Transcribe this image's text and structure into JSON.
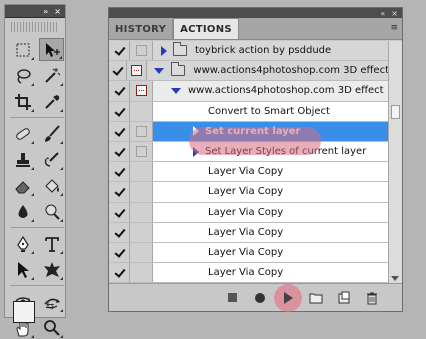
{
  "tools_panel": {
    "collapse_glyph": "»",
    "close_glyph": "×",
    "tools": [
      {
        "name": "rectangular-marquee-icon",
        "active": false
      },
      {
        "name": "move-icon",
        "active": true
      },
      {
        "name": "lasso-icon",
        "active": false
      },
      {
        "name": "magic-wand-icon",
        "active": false
      },
      {
        "name": "crop-icon",
        "active": false
      },
      {
        "name": "eyedropper-icon",
        "active": false
      },
      {
        "name": "healing-brush-icon",
        "active": false
      },
      {
        "name": "brush-icon",
        "active": false
      },
      {
        "name": "clone-stamp-icon",
        "active": false
      },
      {
        "name": "history-brush-icon",
        "active": false
      },
      {
        "name": "eraser-icon",
        "active": false
      },
      {
        "name": "paint-bucket-icon",
        "active": false
      },
      {
        "name": "blur-icon",
        "active": false
      },
      {
        "name": "dodge-icon",
        "active": false
      },
      {
        "name": "pen-icon",
        "active": false
      },
      {
        "name": "type-icon",
        "active": false
      },
      {
        "name": "path-selection-icon",
        "active": false
      },
      {
        "name": "custom-shape-icon",
        "active": false
      },
      {
        "name": "3d-rotate-icon",
        "active": false
      },
      {
        "name": "3d-orbit-icon",
        "active": false
      },
      {
        "name": "hand-icon",
        "active": false
      },
      {
        "name": "zoom-icon",
        "active": false
      }
    ],
    "swap_glyph": "⇆"
  },
  "actions_panel": {
    "window_controls": {
      "collapse": "«",
      "close": "×"
    },
    "tabs": [
      {
        "label": "HISTORY",
        "active": false
      },
      {
        "label": "ACTIONS",
        "active": true
      }
    ],
    "menu_glyph": "≡",
    "rows": [
      {
        "kind": "set",
        "label": "toybrick action by psddude",
        "checked": true,
        "dialog": "empty",
        "toggle": "right",
        "folder": true
      },
      {
        "kind": "set",
        "label": "www.actions4photoshop.com 3D effect",
        "checked": true,
        "dialog": "on",
        "toggle": "down",
        "folder": true
      },
      {
        "kind": "action",
        "label": "www.actions4photoshop.com 3D effect",
        "checked": true,
        "dialog": "on",
        "toggle": "down",
        "folder": false
      },
      {
        "kind": "cmd",
        "label": "Convert to Smart Object",
        "checked": true,
        "dialog": "none",
        "toggle": "none"
      },
      {
        "kind": "cmd",
        "label": "Set current layer",
        "checked": true,
        "dialog": "empty",
        "toggle": "right",
        "selected": true
      },
      {
        "kind": "cmd",
        "label": "Set Layer Styles of current layer",
        "checked": true,
        "dialog": "empty",
        "toggle": "right"
      },
      {
        "kind": "cmd",
        "label": "Layer Via Copy",
        "checked": true,
        "dialog": "none",
        "toggle": "none"
      },
      {
        "kind": "cmd",
        "label": "Layer Via Copy",
        "checked": true,
        "dialog": "none",
        "toggle": "none"
      },
      {
        "kind": "cmd",
        "label": "Layer Via Copy",
        "checked": true,
        "dialog": "none",
        "toggle": "none"
      },
      {
        "kind": "cmd",
        "label": "Layer Via Copy",
        "checked": true,
        "dialog": "none",
        "toggle": "none"
      },
      {
        "kind": "cmd",
        "label": "Layer Via Copy",
        "checked": true,
        "dialog": "none",
        "toggle": "none"
      },
      {
        "kind": "cmd",
        "label": "Layer Via Copy",
        "checked": true,
        "dialog": "none",
        "toggle": "none"
      }
    ],
    "footer_buttons": [
      {
        "name": "stop-playing-button",
        "icon": "stop-icon"
      },
      {
        "name": "begin-recording-button",
        "icon": "record-icon"
      },
      {
        "name": "play-selection-button",
        "icon": "play-icon"
      },
      {
        "name": "create-new-set-button",
        "icon": "folder-icon"
      },
      {
        "name": "create-new-action-button",
        "icon": "new-action-icon"
      },
      {
        "name": "delete-button",
        "icon": "trash-icon"
      }
    ],
    "colors": {
      "selected_row": "#3b8ee8",
      "expand_triangle": "#2a3cb8",
      "dialog_toggle_border": "#8a1f1f",
      "highlight_overlay": "#d66c80"
    }
  }
}
